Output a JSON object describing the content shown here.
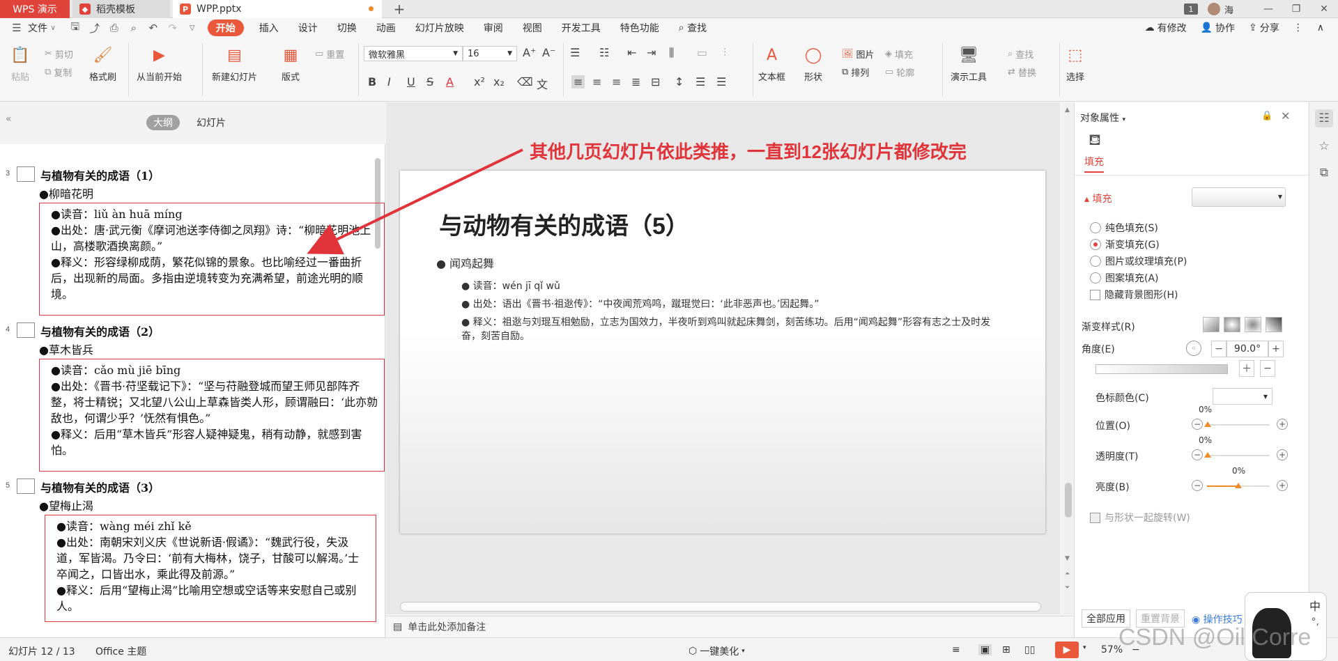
{
  "titlebar": {
    "app_tab": "WPS 演示",
    "template_tab": "稻壳模板",
    "file_tab": "WPP.pptx",
    "new_tab": "+",
    "badge": "1",
    "user": "海"
  },
  "menubar": {
    "file": "文件",
    "items": [
      "开始",
      "插入",
      "设计",
      "切换",
      "动画",
      "幻灯片放映",
      "审阅",
      "视图",
      "开发工具",
      "特色功能"
    ],
    "search": "查找",
    "right": [
      "有修改",
      "协作",
      "分享"
    ]
  },
  "ribbon": {
    "paste": "粘贴",
    "cut": "剪切",
    "copy": "复制",
    "format_painter": "格式刷",
    "from_current": "从当前开始",
    "new_slide": "新建幻灯片",
    "layout": "版式",
    "reset": "重置",
    "font_name": "微软雅黑",
    "font_size": "16",
    "textbox": "文本框",
    "shape": "形状",
    "picture": "图片",
    "fill": "填充",
    "arrange": "排列",
    "outline": "轮廓",
    "present_tools": "演示工具",
    "find": "查找",
    "replace": "替换",
    "select": "选择"
  },
  "left_panel": {
    "tab_outline": "大纲",
    "tab_slides": "幻灯片",
    "slides": [
      {
        "num": "3",
        "title": "与植物有关的成语（1）",
        "idiom": "●柳暗花明",
        "lines": [
          "●读音：liǔ àn huā míng",
          "●出处：唐·武元衡《摩诃池送李侍御之凤翔》诗：“柳暗花明池上山，高楼歌酒换离颜。”",
          "●释义：形容绿柳成荫，繁花似锦的景象。也比喻经过一番曲折后，出现新的局面。多指由逆境转变为充满希望，前途光明的顺境。"
        ]
      },
      {
        "num": "4",
        "title": "与植物有关的成语（2）",
        "idiom": "●草木皆兵",
        "lines": [
          "●读音：cǎo mù jiē bīng",
          "●出处：《晋书·苻坚载记下》：“坚与苻融登城而望王师见部阵齐整，将士精锐；又北望八公山上草森皆类人形，顾谓融曰：‘此亦勍敌也，何谓少乎？’怃然有惧色。”",
          "●释义：后用“草木皆兵”形容人疑神疑鬼，稍有动静，就感到害怕。"
        ]
      },
      {
        "num": "5",
        "title": "与植物有关的成语（3）",
        "idiom": "●望梅止渴",
        "lines": [
          "●读音：wàng méi zhǐ kě",
          "●出处：南朝宋刘义庆《世说新语·假谲》：“魏武行役，失汲道，军皆渴。乃令曰：‘前有大梅林，饶子，甘酸可以解渴。’士卒闻之，口皆出水，乘此得及前源。”",
          "●释义：后用“望梅止渴”比喻用空想或空话等来安慰自己或别人。"
        ]
      }
    ]
  },
  "slide": {
    "title": "与动物有关的成语（5）",
    "idiom": "闻鸡起舞",
    "reading": "读音：wén jī qǐ wǔ",
    "source": "出处：语出《晋书·祖逖传》：“中夜闻荒鸡鸣，蹴琨觉曰：‘此非恶声也。’因起舞。”",
    "meaning": "释义：祖逖与刘琨互相勉励，立志为国效力，半夜听到鸡叫就起床舞剑，刻苦练功。后用“闻鸡起舞”形容有志之士及时发奋，刻苦自励。"
  },
  "annotation": "其他几页幻灯片依此类推，一直到12张幻灯片都修改完",
  "notes_placeholder": "单击此处添加备注",
  "right_panel": {
    "title": "对象属性",
    "tab": "填充",
    "section": "填充",
    "options": [
      "纯色填充(S)",
      "渐变填充(G)",
      "图片或纹理填充(P)",
      "图案填充(A)"
    ],
    "hide_bg": "隐藏背景图形(H)",
    "gradient_style": "渐变样式(R)",
    "angle_label": "角度(E)",
    "angle_value": "90.0°",
    "stop_color": "色标颜色(C)",
    "position_label": "位置(O)",
    "position_value": "0%",
    "transparency_label": "透明度(T)",
    "transparency_value": "0%",
    "brightness_label": "亮度(B)",
    "brightness_value": "0%",
    "rotate_with_shape": "与形状一起旋转(W)",
    "apply_all": "全部应用",
    "reset_bg": "重置背景",
    "tips": "操作技巧"
  },
  "statusbar": {
    "slide_count": "幻灯片 12 / 13",
    "theme": "Office 主题",
    "beautify": "一键美化",
    "zoom": "57%"
  },
  "watermark": "CSDN @Oil Corre",
  "ime": "中"
}
